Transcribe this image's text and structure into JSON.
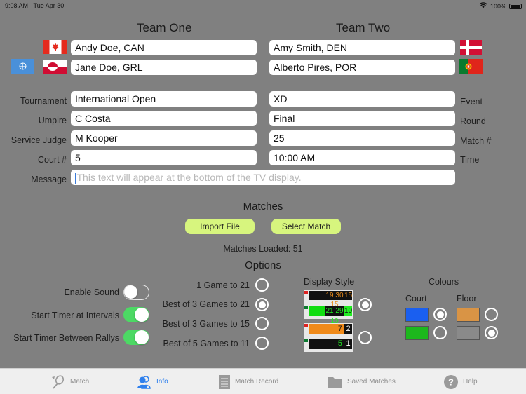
{
  "status_bar": {
    "time": "9:08 AM",
    "date": "Tue Apr 30",
    "battery": "100%"
  },
  "teams": {
    "team_one_title": "Team One",
    "team_two_title": "Team Two",
    "team_one_players": [
      {
        "name": "Andy Doe, CAN",
        "flag": "canada-flag"
      },
      {
        "name": "Jane Doe, GRL",
        "flag": "greenland-flag"
      }
    ],
    "team_two_players": [
      {
        "name": "Amy Smith, DEN",
        "flag": "denmark-flag"
      },
      {
        "name": "Alberto Pires, POR",
        "flag": "portugal-flag"
      }
    ],
    "un_flag_button": "un-flag"
  },
  "details": {
    "left": [
      {
        "label": "Tournament",
        "value": "International Open"
      },
      {
        "label": "Umpire",
        "value": "C Costa"
      },
      {
        "label": "Service Judge",
        "value": "M Kooper"
      },
      {
        "label": "Court #",
        "value": "5"
      }
    ],
    "right": [
      {
        "label": "Event",
        "value": "XD"
      },
      {
        "label": "Round",
        "value": "Final"
      },
      {
        "label": "Match #",
        "value": "25"
      },
      {
        "label": "Time",
        "value": "10:00 AM"
      }
    ],
    "message": {
      "label": "Message",
      "placeholder": "This text will appear at the bottom of the TV display.",
      "value": ""
    }
  },
  "matches": {
    "title": "Matches",
    "import_button": "Import File",
    "select_button": "Select Match",
    "loaded_text": "Matches Loaded: 51"
  },
  "options": {
    "title": "Options",
    "toggles": [
      {
        "label": "Enable Sound",
        "on": false
      },
      {
        "label": "Start Timer at Intervals",
        "on": true
      },
      {
        "label": "Start Timer Between Rallys",
        "on": true
      }
    ],
    "game_formats": [
      {
        "label": "1 Game to 21",
        "selected": false
      },
      {
        "label": "Best of 3 Games to 21",
        "selected": true
      },
      {
        "label": "Best of 3 Games to 15",
        "selected": false
      },
      {
        "label": "Best of 5 Games to 11",
        "selected": false
      }
    ],
    "display_style": {
      "title": "Display Style",
      "styles": [
        {
          "name": "detailed",
          "selected": true,
          "scores_top": "19 30 15",
          "scores_bottom": "21 29 10"
        },
        {
          "name": "compact",
          "selected": false,
          "score_top": "7",
          "games_top": "2",
          "score_bottom": "5",
          "games_bottom": "1"
        }
      ]
    },
    "colours": {
      "title": "Colours",
      "court_label": "Court",
      "floor_label": "Floor",
      "court": [
        {
          "color": "#1a5ff0",
          "selected": true
        },
        {
          "color": "#1db81d",
          "selected": false
        }
      ],
      "floor": [
        {
          "color": "#d99445",
          "selected": false
        },
        {
          "color": "#8a8a8a",
          "selected": true
        }
      ]
    }
  },
  "tabbar": {
    "items": [
      {
        "label": "Match",
        "icon": "badminton-racket-icon",
        "active": false
      },
      {
        "label": "Info",
        "icon": "people-icon",
        "active": true
      },
      {
        "label": "Match Record",
        "icon": "list-document-icon",
        "active": false
      },
      {
        "label": "Saved Matches",
        "icon": "folder-icon",
        "active": false
      },
      {
        "label": "Help",
        "icon": "help-icon",
        "active": false
      }
    ],
    "active_color": "#2f80ed"
  }
}
